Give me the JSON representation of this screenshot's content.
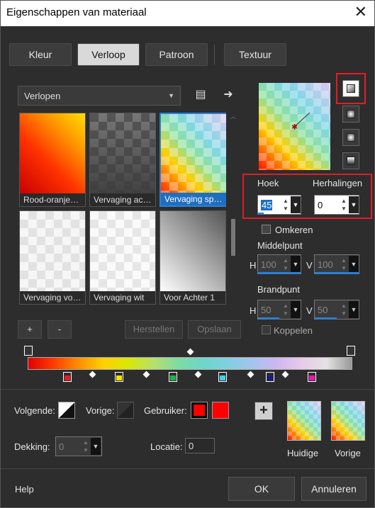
{
  "window": {
    "title": "Eigenschappen van materiaal"
  },
  "tabs": [
    {
      "label": "Kleur",
      "active": false
    },
    {
      "label": "Verloop",
      "active": true
    },
    {
      "label": "Patroon",
      "active": false
    },
    {
      "label": "Textuur",
      "active": false
    }
  ],
  "library": {
    "dropdown_value": "Verlopen",
    "items": [
      {
        "label": "Rood-oranje…",
        "selected": false
      },
      {
        "label": "Vervaging ac…",
        "selected": false
      },
      {
        "label": "Vervaging sp…",
        "selected": true
      },
      {
        "label": "Vervaging vo…",
        "selected": false
      },
      {
        "label": "Vervaging wit",
        "selected": false
      },
      {
        "label": "Voor Achter 1",
        "selected": false
      }
    ],
    "add_label": "+",
    "remove_label": "-",
    "reset_label": "Herstellen",
    "save_label": "Opslaan"
  },
  "settings": {
    "angle_label": "Hoek",
    "angle_value": "45",
    "repeats_label": "Herhalingen",
    "repeats_value": "0",
    "invert_label": "Omkeren",
    "center_label": "Middelpunt",
    "center_h": "100",
    "center_v": "100",
    "focal_label": "Brandpunt",
    "focal_h": "50",
    "focal_v": "50",
    "link_label": "Koppelen",
    "h_label": "H",
    "v_label": "V"
  },
  "stops": {
    "colors": [
      "#e51c23",
      "#f2e600",
      "#1fb24a",
      "#3fd1e6",
      "#1a1a8c",
      "#e61ab0"
    ]
  },
  "bottom": {
    "next_label": "Volgende:",
    "prev_label": "Vorige:",
    "user_label": "Gebruiker:",
    "opacity_label": "Dekking:",
    "opacity_value": "0",
    "location_label": "Locatie:",
    "location_value": "0",
    "user_color": "#ff0000",
    "current_label": "Huidige",
    "previous_label": "Vorige",
    "add_label": "+"
  },
  "footer": {
    "help_label": "Help",
    "ok_label": "OK",
    "cancel_label": "Annuleren"
  }
}
